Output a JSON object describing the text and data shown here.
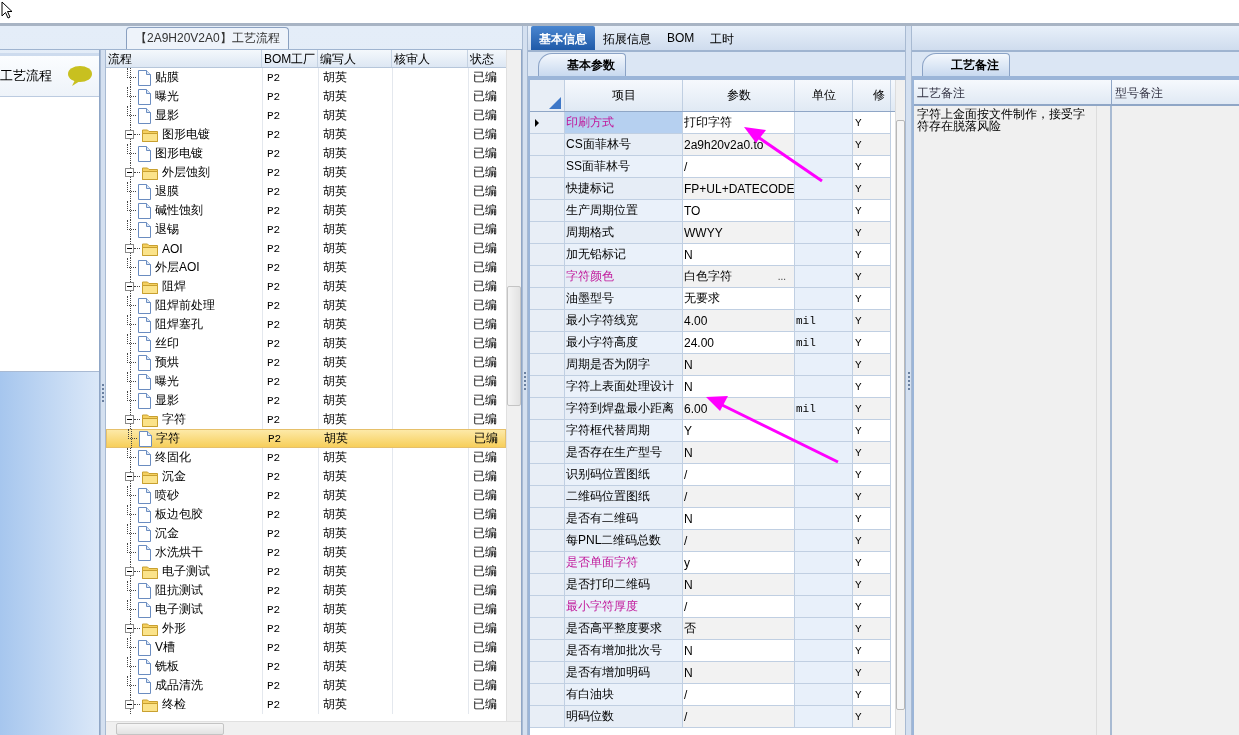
{
  "left_panel": {
    "title": "【2A9H20V2A0】工艺流程",
    "side_header": "工艺流程",
    "tree": {
      "columns": [
        "流程",
        "BOM工厂",
        "编写人",
        "核审人",
        "状态"
      ],
      "nodes": [
        {
          "children": [
            {
              "name": "贴膜",
              "kind": "doc",
              "bom": "P2",
              "author": "胡英",
              "status": "已编",
              "selected": false
            },
            {
              "name": "曝光",
              "kind": "doc",
              "bom": "P2",
              "author": "胡英",
              "status": "已编",
              "selected": false
            },
            {
              "name": "显影",
              "kind": "doc",
              "bom": "P2",
              "author": "胡英",
              "status": "已编",
              "selected": false
            }
          ]
        },
        {
          "name": "图形电镀",
          "kind": "folder",
          "bom": "P2",
          "author": "胡英",
          "status": "已编",
          "selected": false,
          "children": [
            {
              "name": "图形电镀",
              "kind": "doc",
              "bom": "P2",
              "author": "胡英",
              "status": "已编",
              "selected": false
            }
          ]
        },
        {
          "name": "外层蚀刻",
          "kind": "folder",
          "bom": "P2",
          "author": "胡英",
          "status": "已编",
          "selected": false,
          "children": [
            {
              "name": "退膜",
              "kind": "doc",
              "bom": "P2",
              "author": "胡英",
              "status": "已编",
              "selected": false
            },
            {
              "name": "碱性蚀刻",
              "kind": "doc",
              "bom": "P2",
              "author": "胡英",
              "status": "已编",
              "selected": false
            },
            {
              "name": "退锡",
              "kind": "doc",
              "bom": "P2",
              "author": "胡英",
              "status": "已编",
              "selected": false
            }
          ]
        },
        {
          "name": "AOI",
          "kind": "folder",
          "bom": "P2",
          "author": "胡英",
          "status": "已编",
          "selected": false,
          "children": [
            {
              "name": "外层AOI",
              "kind": "doc",
              "bom": "P2",
              "author": "胡英",
              "status": "已编",
              "selected": false
            }
          ]
        },
        {
          "name": "阻焊",
          "kind": "folder",
          "bom": "P2",
          "author": "胡英",
          "status": "已编",
          "selected": false,
          "children": [
            {
              "name": "阻焊前处理",
              "kind": "doc",
              "bom": "P2",
              "author": "胡英",
              "status": "已编",
              "selected": false
            },
            {
              "name": "阻焊塞孔",
              "kind": "doc",
              "bom": "P2",
              "author": "胡英",
              "status": "已编",
              "selected": false
            },
            {
              "name": "丝印",
              "kind": "doc",
              "bom": "P2",
              "author": "胡英",
              "status": "已编",
              "selected": false
            },
            {
              "name": "预烘",
              "kind": "doc",
              "bom": "P2",
              "author": "胡英",
              "status": "已编",
              "selected": false
            },
            {
              "name": "曝光",
              "kind": "doc",
              "bom": "P2",
              "author": "胡英",
              "status": "已编",
              "selected": false
            },
            {
              "name": "显影",
              "kind": "doc",
              "bom": "P2",
              "author": "胡英",
              "status": "已编",
              "selected": false
            }
          ]
        },
        {
          "name": "字符",
          "kind": "folder",
          "bom": "P2",
          "author": "胡英",
          "status": "已编",
          "selected": false,
          "children": [
            {
              "name": "字符",
              "kind": "doc",
              "bom": "P2",
              "author": "胡英",
              "status": "已编",
              "selected": true
            },
            {
              "name": "终固化",
              "kind": "doc",
              "bom": "P2",
              "author": "胡英",
              "status": "已编",
              "selected": false
            }
          ]
        },
        {
          "name": "沉金",
          "kind": "folder",
          "bom": "P2",
          "author": "胡英",
          "status": "已编",
          "selected": false,
          "children": [
            {
              "name": "喷砂",
              "kind": "doc",
              "bom": "P2",
              "author": "胡英",
              "status": "已编",
              "selected": false
            },
            {
              "name": "板边包胶",
              "kind": "doc",
              "bom": "P2",
              "author": "胡英",
              "status": "已编",
              "selected": false
            },
            {
              "name": "沉金",
              "kind": "doc",
              "bom": "P2",
              "author": "胡英",
              "status": "已编",
              "selected": false
            },
            {
              "name": "水洗烘干",
              "kind": "doc",
              "bom": "P2",
              "author": "胡英",
              "status": "已编",
              "selected": false
            }
          ]
        },
        {
          "name": "电子测试",
          "kind": "folder",
          "bom": "P2",
          "author": "胡英",
          "status": "已编",
          "selected": false,
          "children": [
            {
              "name": "阻抗测试",
              "kind": "doc",
              "bom": "P2",
              "author": "胡英",
              "status": "已编",
              "selected": false
            },
            {
              "name": "电子测试",
              "kind": "doc",
              "bom": "P2",
              "author": "胡英",
              "status": "已编",
              "selected": false
            }
          ]
        },
        {
          "name": "外形",
          "kind": "folder",
          "bom": "P2",
          "author": "胡英",
          "status": "已编",
          "selected": false,
          "children": [
            {
              "name": "V槽",
              "kind": "doc",
              "bom": "P2",
              "author": "胡英",
              "status": "已编",
              "selected": false
            },
            {
              "name": "铣板",
              "kind": "doc",
              "bom": "P2",
              "author": "胡英",
              "status": "已编",
              "selected": false
            },
            {
              "name": "成品清洗",
              "kind": "doc",
              "bom": "P2",
              "author": "胡英",
              "status": "已编",
              "selected": false
            }
          ]
        },
        {
          "name": "终检",
          "kind": "folder",
          "bom": "P2",
          "author": "胡英",
          "status": "已编",
          "selected": false
        }
      ]
    }
  },
  "main_tabs": [
    {
      "label": "基本信息",
      "selected": true
    },
    {
      "label": "拓展信息",
      "selected": false
    },
    {
      "label": "BOM",
      "selected": false
    },
    {
      "label": "工时",
      "selected": false
    }
  ],
  "params": {
    "subtab": "基本参数",
    "columns": [
      "项目",
      "参数",
      "单位",
      "修"
    ],
    "rows": [
      {
        "item": "印刷方式",
        "value": "打印字符",
        "modified": "Y",
        "highlighted": true,
        "selected": true
      },
      {
        "item": "CS面菲林号",
        "value": "2a9h20v2a0.to",
        "modified": "Y",
        "highlighted": false,
        "selected": false
      },
      {
        "item": "SS面菲林号",
        "value": "/",
        "modified": "Y",
        "highlighted": false,
        "selected": false
      },
      {
        "item": "快捷标记",
        "value": "FP+UL+DATECODE",
        "modified": "Y",
        "highlighted": false,
        "selected": false
      },
      {
        "item": "生产周期位置",
        "value": "TO",
        "modified": "Y",
        "highlighted": false,
        "selected": false
      },
      {
        "item": "周期格式",
        "value": "WWYY",
        "modified": "Y",
        "highlighted": false,
        "selected": false
      },
      {
        "item": "加无铅标记",
        "value": "N",
        "modified": "Y",
        "highlighted": false,
        "selected": false
      },
      {
        "item": "字符颜色",
        "value": "白色字符",
        "button": "...",
        "modified": "Y",
        "highlighted": true,
        "selected": false
      },
      {
        "item": "油墨型号",
        "value": "无要求",
        "modified": "Y",
        "highlighted": false,
        "selected": false
      },
      {
        "item": "最小字符线宽",
        "value": "4.00",
        "unit": "mil",
        "modified": "Y",
        "highlighted": false,
        "selected": false
      },
      {
        "item": "最小字符高度",
        "value": "24.00",
        "unit": "mil",
        "modified": "Y",
        "highlighted": false,
        "selected": false
      },
      {
        "item": "周期是否为阴字",
        "value": "N",
        "modified": "Y",
        "highlighted": false,
        "selected": false
      },
      {
        "item": "字符上表面处理设计",
        "value": "N",
        "modified": "Y",
        "highlighted": false,
        "selected": false
      },
      {
        "item": "字符到焊盘最小距离",
        "value": "6.00",
        "unit": "mil",
        "modified": "Y",
        "highlighted": false,
        "selected": false
      },
      {
        "item": "字符框代替周期",
        "value": "Y",
        "modified": "Y",
        "highlighted": false,
        "selected": false
      },
      {
        "item": "是否存在生产型号",
        "value": "N",
        "modified": "Y",
        "highlighted": false,
        "selected": false
      },
      {
        "item": "识别码位置图纸",
        "value": "/",
        "modified": "Y",
        "highlighted": false,
        "selected": false
      },
      {
        "item": "二维码位置图纸",
        "value": "/",
        "modified": "Y",
        "highlighted": false,
        "selected": false
      },
      {
        "item": "是否有二维码",
        "value": "N",
        "modified": "Y",
        "highlighted": false,
        "selected": false
      },
      {
        "item": "每PNL二维码总数",
        "value": "/",
        "modified": "Y",
        "highlighted": false,
        "selected": false
      },
      {
        "item": "是否单面字符",
        "value": "y",
        "modified": "Y",
        "highlighted": true,
        "selected": false
      },
      {
        "item": "是否打印二维码",
        "value": "N",
        "modified": "Y",
        "highlighted": false,
        "selected": false
      },
      {
        "item": "最小字符厚度",
        "value": "/",
        "modified": "Y",
        "highlighted": true,
        "selected": false
      },
      {
        "item": "是否高平整度要求",
        "value": "否",
        "modified": "Y",
        "highlighted": false,
        "selected": false
      },
      {
        "item": "是否有增加批次号",
        "value": "N",
        "modified": "Y",
        "highlighted": false,
        "selected": false
      },
      {
        "item": "是否有增加明码",
        "value": "N",
        "modified": "Y",
        "highlighted": false,
        "selected": false
      },
      {
        "item": "有白油块",
        "value": "/",
        "modified": "Y",
        "highlighted": false,
        "selected": false
      },
      {
        "item": "明码位数",
        "value": "/",
        "modified": "Y",
        "highlighted": false,
        "selected": false
      }
    ]
  },
  "notes": {
    "subtab": "工艺备注",
    "columns": [
      "工艺备注",
      "型号备注"
    ],
    "process_note": "字符上金面按文件制作，接受字符存在脱落风险"
  }
}
